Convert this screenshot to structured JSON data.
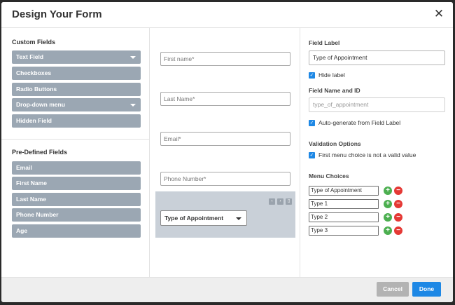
{
  "dialog": {
    "title": "Design Your Form",
    "close_label": "✕"
  },
  "custom_fields": {
    "title": "Custom Fields",
    "items": [
      {
        "label": "Text Field",
        "has_caret": true
      },
      {
        "label": "Checkboxes",
        "has_caret": false
      },
      {
        "label": "Radio Buttons",
        "has_caret": false
      },
      {
        "label": "Drop-down menu",
        "has_caret": true
      },
      {
        "label": "Hidden Field",
        "has_caret": false
      }
    ]
  },
  "predefined_fields": {
    "title": "Pre-Defined Fields",
    "items": [
      {
        "label": "Email"
      },
      {
        "label": "First Name"
      },
      {
        "label": "Last Name"
      },
      {
        "label": "Phone Number"
      },
      {
        "label": "Age"
      }
    ]
  },
  "form_preview": {
    "fields": [
      {
        "placeholder": "First name*"
      },
      {
        "placeholder": "Last Name*"
      },
      {
        "placeholder": "Email*"
      },
      {
        "placeholder": "Phone Number*"
      }
    ],
    "selected_dropdown": {
      "value": "Type of Appointment"
    }
  },
  "properties": {
    "field_label_title": "Field Label",
    "field_label_value": "Type of Appointment",
    "hide_label": {
      "label": "Hide label",
      "checked": true
    },
    "field_name_title": "Field Name and ID",
    "field_name_placeholder": "type_of_appointment",
    "auto_generate": {
      "label": "Auto-generate from Field Label",
      "checked": true
    },
    "validation_title": "Validation Options",
    "first_choice_invalid": {
      "label": "First menu choice is not a valid value",
      "checked": true
    },
    "menu_choices_title": "Menu Choices",
    "choices": [
      {
        "value": "Type of Appointment"
      },
      {
        "value": "Type 1"
      },
      {
        "value": "Type 2"
      },
      {
        "value": "Type 3"
      }
    ]
  },
  "footer": {
    "cancel_label": "Cancel",
    "done_label": "Done"
  },
  "colors": {
    "field_button_bg": "#9ba7b3",
    "primary": "#1e88e5",
    "add": "#4caf50",
    "remove": "#e53935"
  },
  "icons": {
    "close": "close-icon",
    "add": "plus-circle-icon",
    "remove": "minus-circle-icon",
    "check": "checkmark-icon"
  }
}
